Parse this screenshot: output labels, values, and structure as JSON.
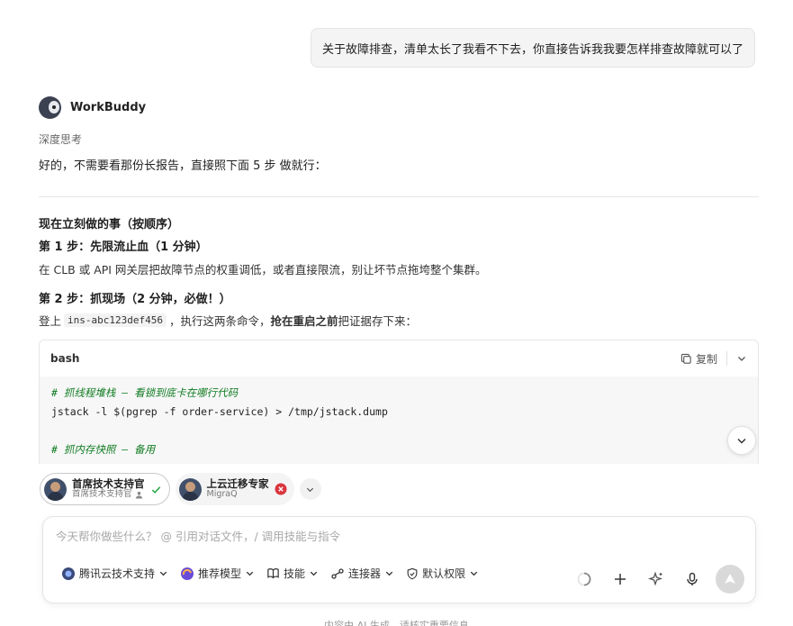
{
  "user_message": "关于故障排查，清单太长了我看不下去，你直接告诉我我要怎样排查故障就可以了",
  "assistant": {
    "name": "WorkBuddy",
    "thinking_label": "深度思考",
    "intro": "好的，不需要看那份长报告，直接照下面 5 步 做就行："
  },
  "content": {
    "heading": "现在立刻做的事（按顺序）",
    "step1_title": "第 1 步：先限流止血（1 分钟）",
    "step1_body": "在 CLB 或 API 网关层把故障节点的权重调低，或者直接限流，别让坏节点拖垮整个集群。",
    "step2_title": "第 2 步：抓现场（2 分钟，必做！）",
    "step2_prefix": "登上",
    "step2_code": "ins-abc123def456",
    "step2_mid": "，执行这两条命令，",
    "step2_bold": "抢在重启之前",
    "step2_suffix": "把证据存下来："
  },
  "code_block": {
    "language": "bash",
    "copy_label": "复制",
    "comment1": "# 抓线程堆栈 — 看锁到底卡在哪行代码",
    "line1": "jstack -l $(pgrep -f order-service) > /tmp/jstack.dump",
    "comment2": "# 抓内存快照 — 备用"
  },
  "agents": [
    {
      "name": "首席技术支持官",
      "sub": "首席技术支持官",
      "status": "selected"
    },
    {
      "name": "上云迁移专家",
      "sub": "MigraQ",
      "status": "error"
    }
  ],
  "composer": {
    "placeholder": "今天帮你做些什么？ @ 引用对话文件，/ 调用技能与指令",
    "tools": {
      "workspace": "腾讯云技术支持",
      "model": "推荐模型",
      "skills": "技能",
      "connectors": "连接器",
      "permissions": "默认权限"
    }
  },
  "footer_note": "内容由 AI 生成，请核实重要信息",
  "colors": {
    "comment": "#0f7b1f",
    "success": "#22a447",
    "error": "#d9363e"
  }
}
